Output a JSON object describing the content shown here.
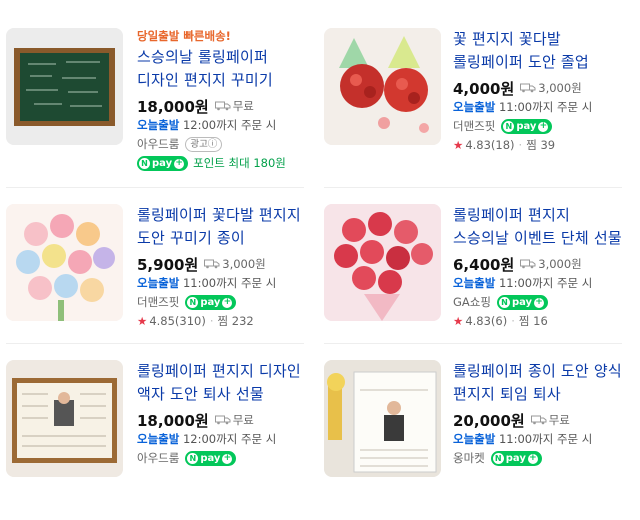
{
  "products": [
    {
      "promo": "당일출발 빠른배송!",
      "title": "스승의날 롤링페이퍼 디자인 편지지 꾸미기",
      "price": "18,000원",
      "shipping": "무료",
      "dispatch_tag": "오늘출발",
      "dispatch_text": "12:00까지 주문 시",
      "seller": "아우드룸",
      "ad_label": "광고ⓘ",
      "point_text": "포인트 최대 180원",
      "npay_label": "pay"
    },
    {
      "title": "꽃 편지지 꽃다발 롤링페이퍼 도안 졸업 스승의날",
      "price": "4,000원",
      "shipping": "3,000원",
      "dispatch_tag": "오늘출발",
      "dispatch_text": "11:00까지 주문 시",
      "seller": "더맨즈핏",
      "npay_label": "pay",
      "rating": "4.83",
      "reviews": "(18)",
      "wish_label": "찜",
      "wish_count": "39"
    },
    {
      "title": "롤링페이퍼 꽃다발 편지지 도안 꾸미기 종이",
      "price": "5,900원",
      "shipping": "3,000원",
      "dispatch_tag": "오늘출발",
      "dispatch_text": "11:00까지 주문 시",
      "seller": "더맨즈핏",
      "npay_label": "pay",
      "rating": "4.85",
      "reviews": "(310)",
      "wish_label": "찜",
      "wish_count": "232"
    },
    {
      "title": "롤링페이퍼 편지지 스승의날 이벤트 단체 선물",
      "price": "6,400원",
      "shipping": "3,000원",
      "dispatch_tag": "오늘출발",
      "dispatch_text": "11:00까지 주문 시",
      "seller": "GA쇼핑",
      "npay_label": "pay",
      "rating": "4.83",
      "reviews": "(6)",
      "wish_label": "찜",
      "wish_count": "16"
    },
    {
      "title": "롤링페이퍼 편지지 디자인 액자 도안 퇴사 선물",
      "price": "18,000원",
      "shipping": "무료",
      "dispatch_tag": "오늘출발",
      "dispatch_text": "12:00까지 주문 시",
      "seller": "아우드룸",
      "npay_label": "pay"
    },
    {
      "title": "롤링페이퍼 종이 도안 양식 편지지 퇴임 퇴사",
      "price": "20,000원",
      "shipping": "무료",
      "dispatch_tag": "오늘출발",
      "dispatch_text": "11:00까지 주문 시",
      "seller": "옹마켓",
      "npay_label": "pay"
    }
  ],
  "colors": {
    "title": "#0a3aa8",
    "fast": "#0a63d9",
    "npay": "#03c75a",
    "promo": "#e8672c",
    "star": "#e6394b"
  },
  "icons": {
    "shipping": "truck-icon",
    "rating": "star-icon",
    "npay": "npay-badge"
  }
}
